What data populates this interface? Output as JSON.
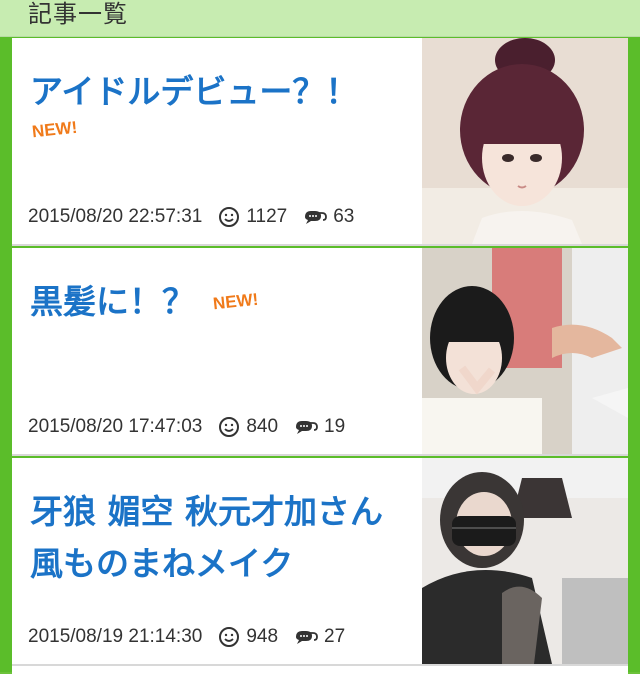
{
  "header": {
    "title": "記事一覧"
  },
  "articles": [
    {
      "title": "アイドルデビュー？！",
      "new_label": "NEW!",
      "datetime": "2015/08/20 22:57:31",
      "views": "1127",
      "comments": "63"
    },
    {
      "title": "黒髪に！？",
      "new_label": "NEW!",
      "datetime": "2015/08/20 17:47:03",
      "views": "840",
      "comments": "19"
    },
    {
      "title": "牙狼 媚空 秋元才加さん風ものまねメイク",
      "new_label": "",
      "datetime": "2015/08/19 21:14:30",
      "views": "948",
      "comments": "27"
    }
  ],
  "icons": {
    "view": "smiley-face-icon",
    "comment": "speech-bubble-icon"
  },
  "colors": {
    "frame": "#5bbd2a",
    "header_bg": "#c7ecb1",
    "title": "#1b73c7",
    "new_badge": "#f07a1a",
    "meta_text": "#333333"
  }
}
